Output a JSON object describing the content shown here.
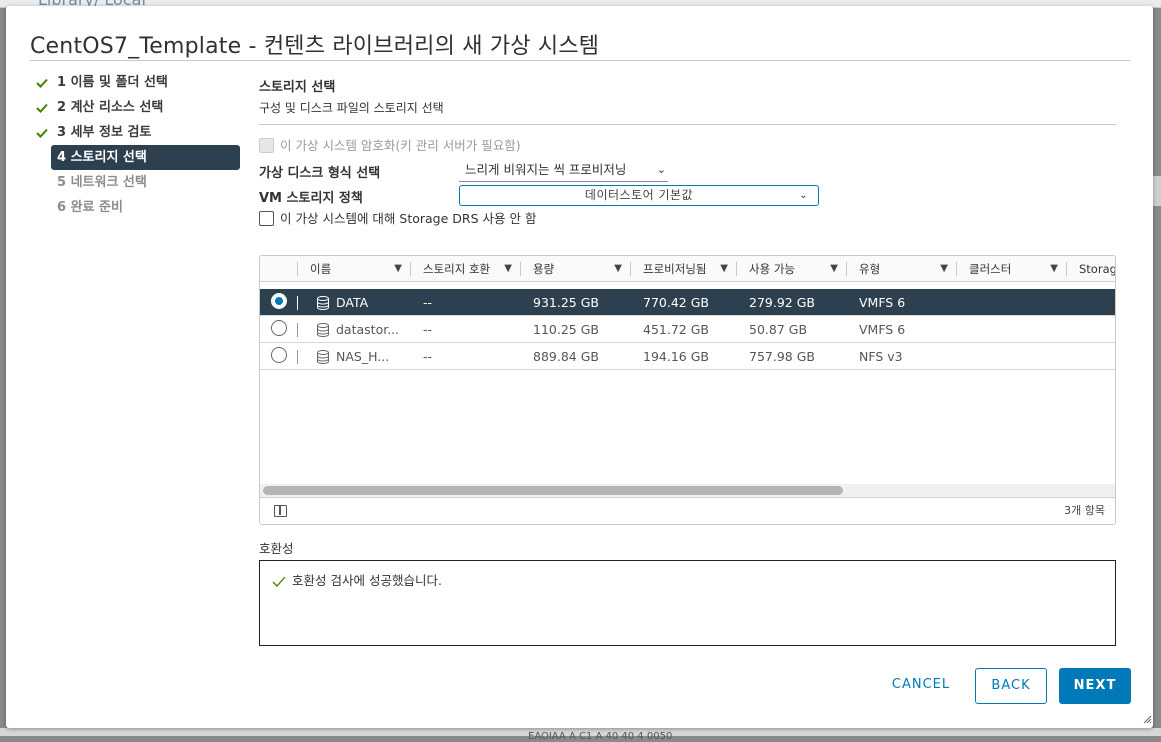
{
  "background": {
    "top_text": "Library/ Local",
    "bottom_text": "EAOIAA A C1 A 40 40 4 0050"
  },
  "dialog": {
    "title": "CentOS7_Template - 컨텐츠 라이브러리의 새 가상 시스템"
  },
  "steps": [
    {
      "label": "1 이름 및 폴더 선택",
      "state": "done"
    },
    {
      "label": "2 계산 리소스 선택",
      "state": "done"
    },
    {
      "label": "3 세부 정보 검토",
      "state": "done"
    },
    {
      "label": "4 스토리지 선택",
      "state": "active"
    },
    {
      "label": "5 네트워크 선택",
      "state": "pending"
    },
    {
      "label": "6 완료 준비",
      "state": "pending"
    }
  ],
  "section": {
    "title": "스토리지 선택",
    "subtitle": "구성 및 디스크 파일의 스토리지 선택"
  },
  "encrypt_checkbox": {
    "label": "이 가상 시스템 암호화(키 관리 서버가 필요함)",
    "checked": false,
    "disabled": true
  },
  "disk_format": {
    "label": "가상 디스크 형식 선택",
    "value": "느리게 비워지는 씩 프로비저닝"
  },
  "storage_policy": {
    "label": "VM 스토리지 정책",
    "value": "데이터스토어 기본값"
  },
  "drs_checkbox": {
    "label": "이 가상 시스템에 대해 Storage DRS 사용 안 함",
    "checked": false
  },
  "grid": {
    "columns": [
      "이름",
      "스토리지 호환",
      "용량",
      "프로비저닝됨",
      "사용 가능",
      "유형",
      "클러스터",
      "Storag"
    ],
    "rows": [
      {
        "name": "DATA",
        "compat": "--",
        "capacity": "931.25 GB",
        "provisioned": "770.42 GB",
        "free": "279.92 GB",
        "type": "VMFS 6",
        "cluster": "",
        "selected": true
      },
      {
        "name": "datastor...",
        "compat": "--",
        "capacity": "110.25 GB",
        "provisioned": "451.72 GB",
        "free": "50.87 GB",
        "type": "VMFS 6",
        "cluster": "",
        "selected": false
      },
      {
        "name": "NAS_H...",
        "compat": "--",
        "capacity": "889.84 GB",
        "provisioned": "194.16 GB",
        "free": "757.98 GB",
        "type": "NFS v3",
        "cluster": "",
        "selected": false
      }
    ],
    "item_count": "3개 항목"
  },
  "compatibility": {
    "label": "호환성",
    "message": "호환성 검사에 성공했습니다."
  },
  "buttons": {
    "cancel": "CANCEL",
    "back": "BACK",
    "next": "NEXT"
  },
  "colors": {
    "accent": "#0079b8",
    "selected_row": "#2c4050",
    "check_green": "#3c8500"
  }
}
